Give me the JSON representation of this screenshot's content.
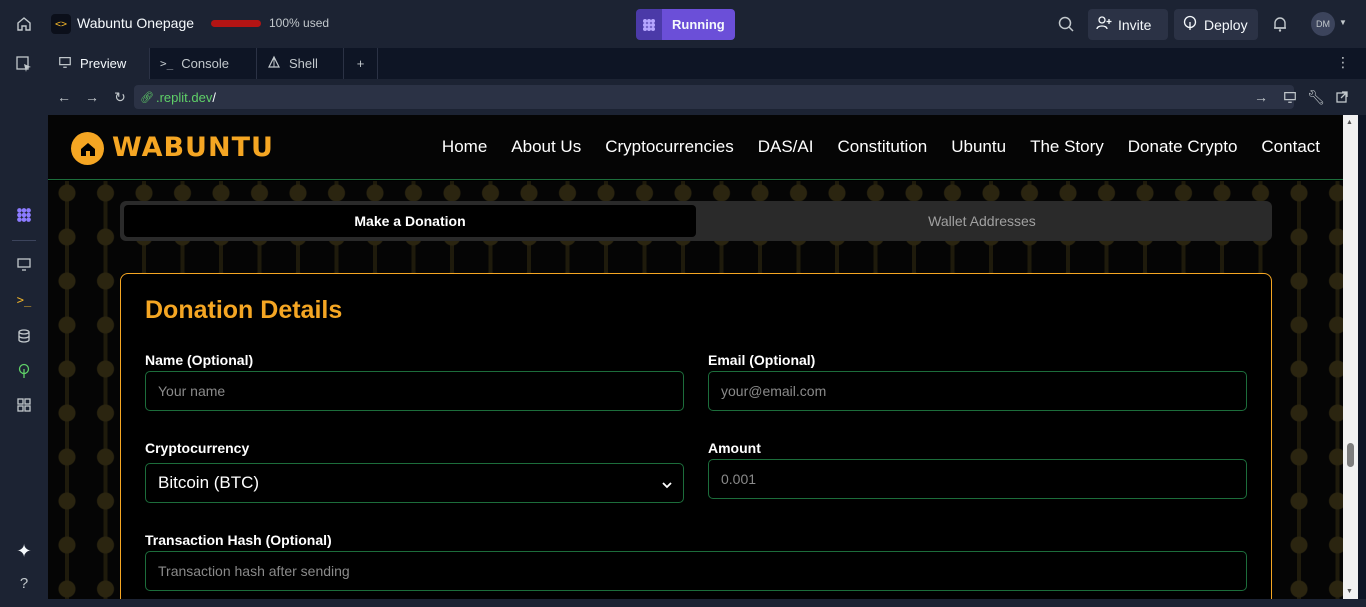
{
  "topbar": {
    "repl_name": "Wabuntu Onepage",
    "usage_text": "100% used",
    "usage_fraction": 1.0,
    "run_label": "Running",
    "invite_label": "Invite",
    "deploy_label": "Deploy",
    "avatar_initials": "DM"
  },
  "tabs": [
    {
      "label": "Preview",
      "icon": "monitor-icon",
      "active": true
    },
    {
      "label": "Console",
      "icon": "terminal-icon",
      "active": false
    },
    {
      "label": "Shell",
      "icon": "shell-icon",
      "active": false
    }
  ],
  "url": {
    "host": ".replit.dev",
    "path": "/"
  },
  "site": {
    "logo_text": "WABUNTU",
    "nav": [
      "Home",
      "About Us",
      "Cryptocurrencies",
      "DAS/AI",
      "Constitution",
      "Ubuntu",
      "The Story",
      "Donate Crypto",
      "Contact"
    ]
  },
  "segments": {
    "donate": "Make a Donation",
    "wallets": "Wallet Addresses"
  },
  "form": {
    "title": "Donation Details",
    "name_label": "Name (Optional)",
    "name_placeholder": "Your name",
    "email_label": "Email (Optional)",
    "email_placeholder": "your@email.com",
    "crypto_label": "Cryptocurrency",
    "crypto_value": "Bitcoin (BTC)",
    "amount_label": "Amount",
    "amount_placeholder": "0.001",
    "hash_label": "Transaction Hash (Optional)",
    "hash_placeholder": "Transaction hash after sending"
  },
  "colors": {
    "accent": "#f5a623",
    "run": "#6b4fd8",
    "field_border": "#1c6d3b",
    "url_host": "#5fd068"
  }
}
